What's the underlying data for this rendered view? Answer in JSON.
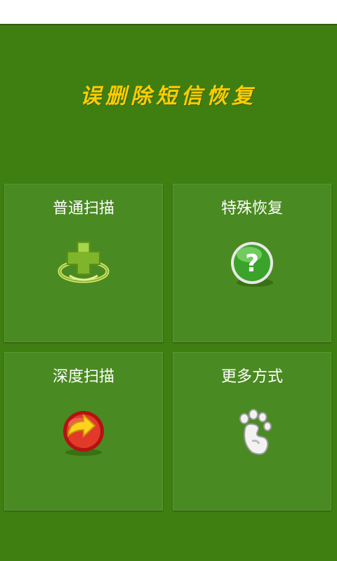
{
  "app": {
    "title": "误删除短信恢复"
  },
  "colors": {
    "background": "#3f7f12",
    "tile": "#4a8a22",
    "title": "#ffcc00"
  },
  "tiles": [
    {
      "label": "普通扫描",
      "icon": "green-cross-scan-icon"
    },
    {
      "label": "特殊恢复",
      "icon": "green-question-icon"
    },
    {
      "label": "深度扫描",
      "icon": "red-refresh-arrow-icon"
    },
    {
      "label": "更多方式",
      "icon": "footprint-icon"
    }
  ]
}
